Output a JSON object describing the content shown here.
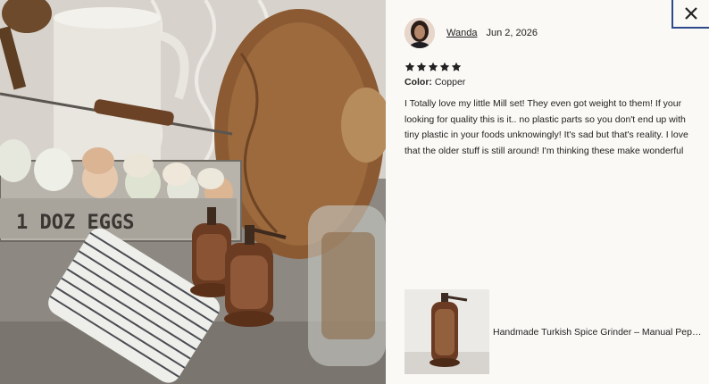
{
  "close_button": {
    "icon": "close-icon",
    "label": "×"
  },
  "photo": {
    "description_icon": "review-photo",
    "stamp_text": "1 DOZ EGGS"
  },
  "review": {
    "reviewer_name": "Wanda",
    "date": "Jun 2, 2026",
    "rating": 5,
    "rating_max": 5,
    "variant_label": "Color:",
    "variant_value": "Copper",
    "text": "I Totally love my little Mill set! They even got weight to them! If your looking for quality this is it.. no plastic parts so you don't end up with tiny plastic in your foods unknowingly! It's sad but that's reality. I love that the older stuff is still around! I'm thinking these make wonderful gifts! I'm a farmhouse girl and"
  },
  "product": {
    "title": "Handmade Turkish Spice Grinder – Manual Pepper ..."
  },
  "colors": {
    "accent_border": "#2d4a8c",
    "star": "#222222",
    "text": "#222222",
    "panel_bg": "#fbf9f5"
  }
}
